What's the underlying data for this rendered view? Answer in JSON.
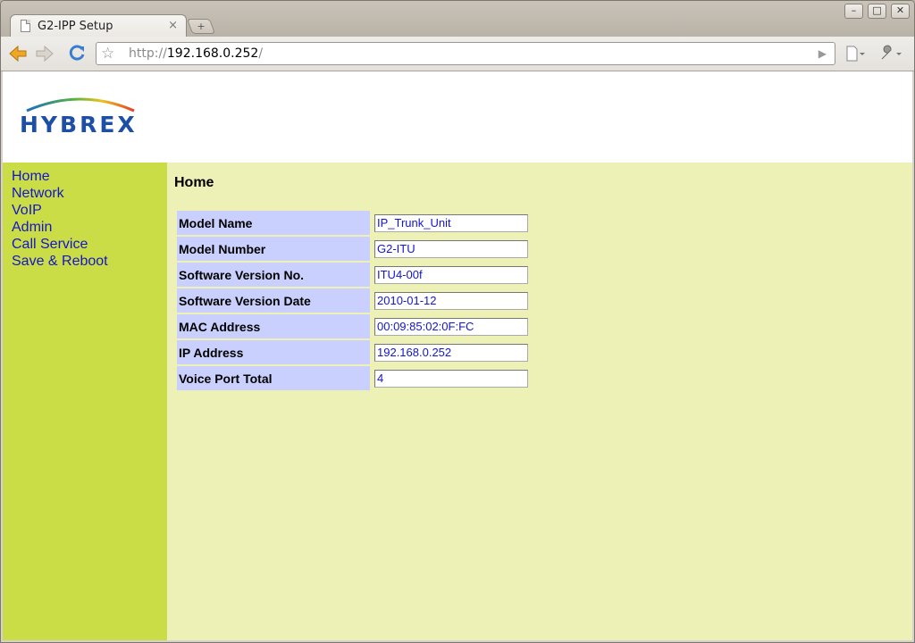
{
  "browser": {
    "tab_title": "G2-IPP Setup",
    "tab_close": "×",
    "new_tab": "+",
    "window_controls": {
      "minimize": "–",
      "maximize": "□",
      "close": "✕"
    },
    "url": {
      "scheme": "http://",
      "host": "192.168.0.252",
      "path": "/"
    },
    "icons": [
      "back-icon",
      "forward-icon",
      "reload-icon",
      "star-icon",
      "go-icon",
      "page-menu-icon",
      "wrench-icon"
    ]
  },
  "brand": {
    "logo_text": "HYBREX"
  },
  "nav": {
    "items": [
      "Home",
      "Network",
      "VoIP",
      "Admin",
      "Call Service",
      "Save & Reboot"
    ]
  },
  "page": {
    "title": "Home",
    "fields": [
      {
        "label": "Model Name",
        "value": "IP_Trunk_Unit"
      },
      {
        "label": "Model Number",
        "value": "G2-ITU"
      },
      {
        "label": "Software Version No.",
        "value": "ITU4-00f"
      },
      {
        "label": "Software Version Date",
        "value": "2010-01-12"
      },
      {
        "label": "MAC Address",
        "value": "00:09:85:02:0F:FC"
      },
      {
        "label": "IP Address",
        "value": "192.168.0.252"
      },
      {
        "label": "Voice Port Total",
        "value": "4"
      }
    ]
  },
  "colors": {
    "sidebar": "#cadc46",
    "content": "#edf1b5",
    "label_cell": "#c9d0fd",
    "link": "#1316c9"
  }
}
